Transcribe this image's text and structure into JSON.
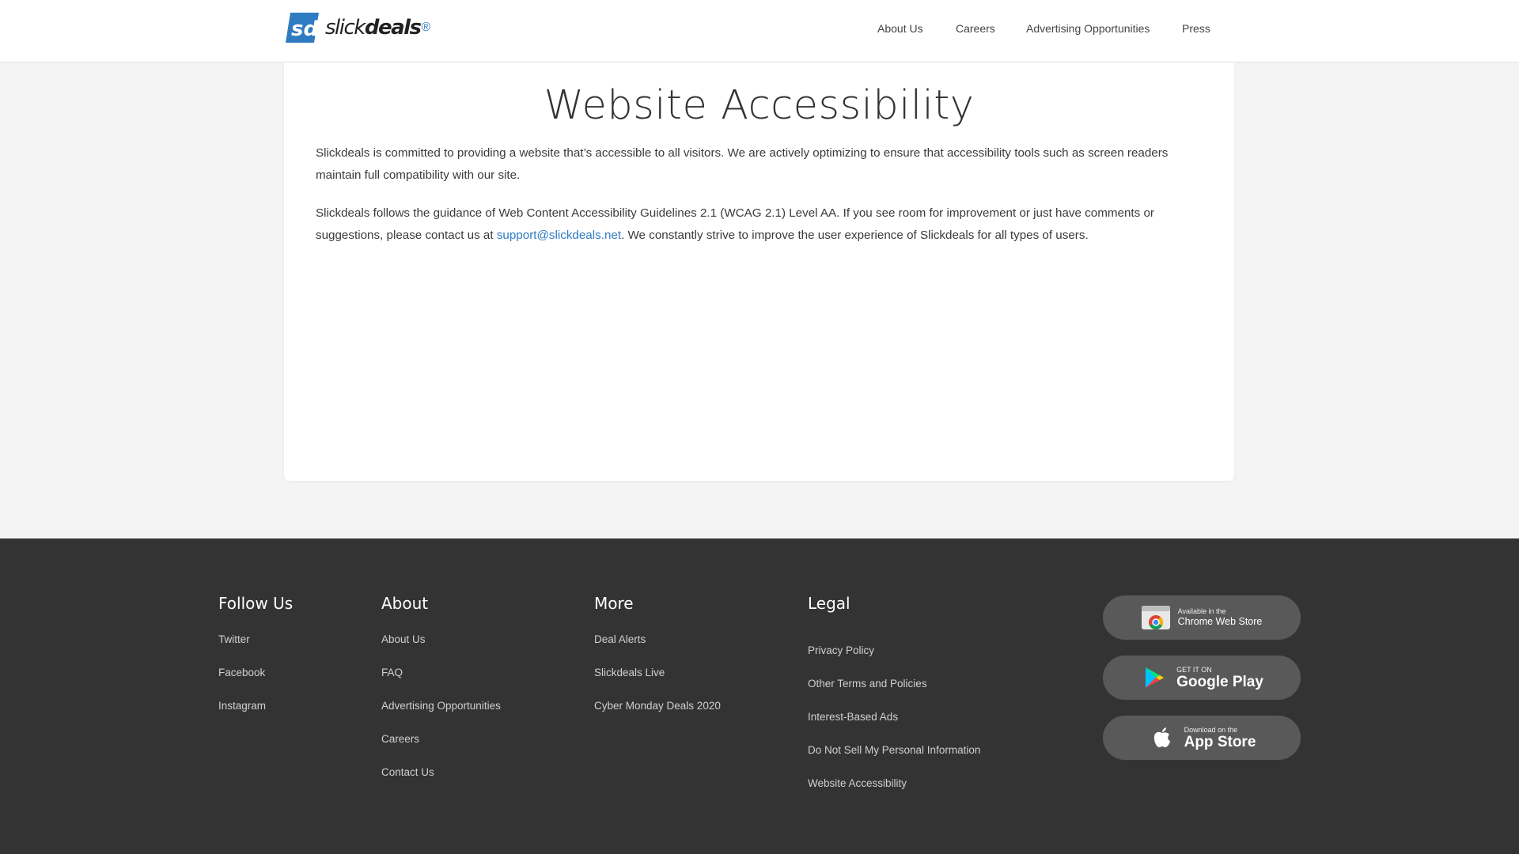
{
  "header": {
    "logo_text_light": "slick",
    "logo_text_bold": "deals",
    "logo_mark": "®",
    "nav": [
      "About Us",
      "Careers",
      "Advertising Opportunities",
      "Press"
    ]
  },
  "main": {
    "title": "Website Accessibility",
    "para1": "Slickdeals is committed to providing a website that’s accessible to all visitors. We are actively optimizing to ensure that accessibility tools such as screen readers maintain full compatibility with our site.",
    "para2_before": "Slickdeals follows the guidance of Web Content Accessibility Guidelines 2.1 (WCAG 2.1) Level AA. If you see room for improvement or just have comments or suggestions, please contact us at ",
    "para2_link": "support@slickdeals.net",
    "para2_after": ". We constantly strive to improve the user experience of Slickdeals for all types of users."
  },
  "footer": {
    "follow": {
      "heading": "Follow Us",
      "items": [
        "Twitter",
        "Facebook",
        "Instagram"
      ]
    },
    "about": {
      "heading": "About",
      "items": [
        "About Us",
        "FAQ",
        "Advertising Opportunities",
        "Careers",
        "Contact Us"
      ]
    },
    "more": {
      "heading": "More",
      "items": [
        "Deal Alerts",
        "Slickdeals Live",
        "Cyber Monday Deals 2020"
      ]
    },
    "legal": {
      "heading": "Legal",
      "items": [
        "Privacy Policy",
        "Other Terms and Policies",
        "Interest-Based Ads",
        "Do Not Sell My Personal Information",
        "Website Accessibility"
      ]
    },
    "badges": {
      "chrome": {
        "small": "Available in the",
        "big": "Chrome Web Store"
      },
      "google": {
        "small": "GET IT ON",
        "big": "Google Play"
      },
      "apple": {
        "small": "Download on the",
        "big": "App Store"
      }
    }
  },
  "colors": {
    "link": "#2f7bc2",
    "footer_bg": "#333333",
    "page_bg": "#f4f4f4"
  }
}
